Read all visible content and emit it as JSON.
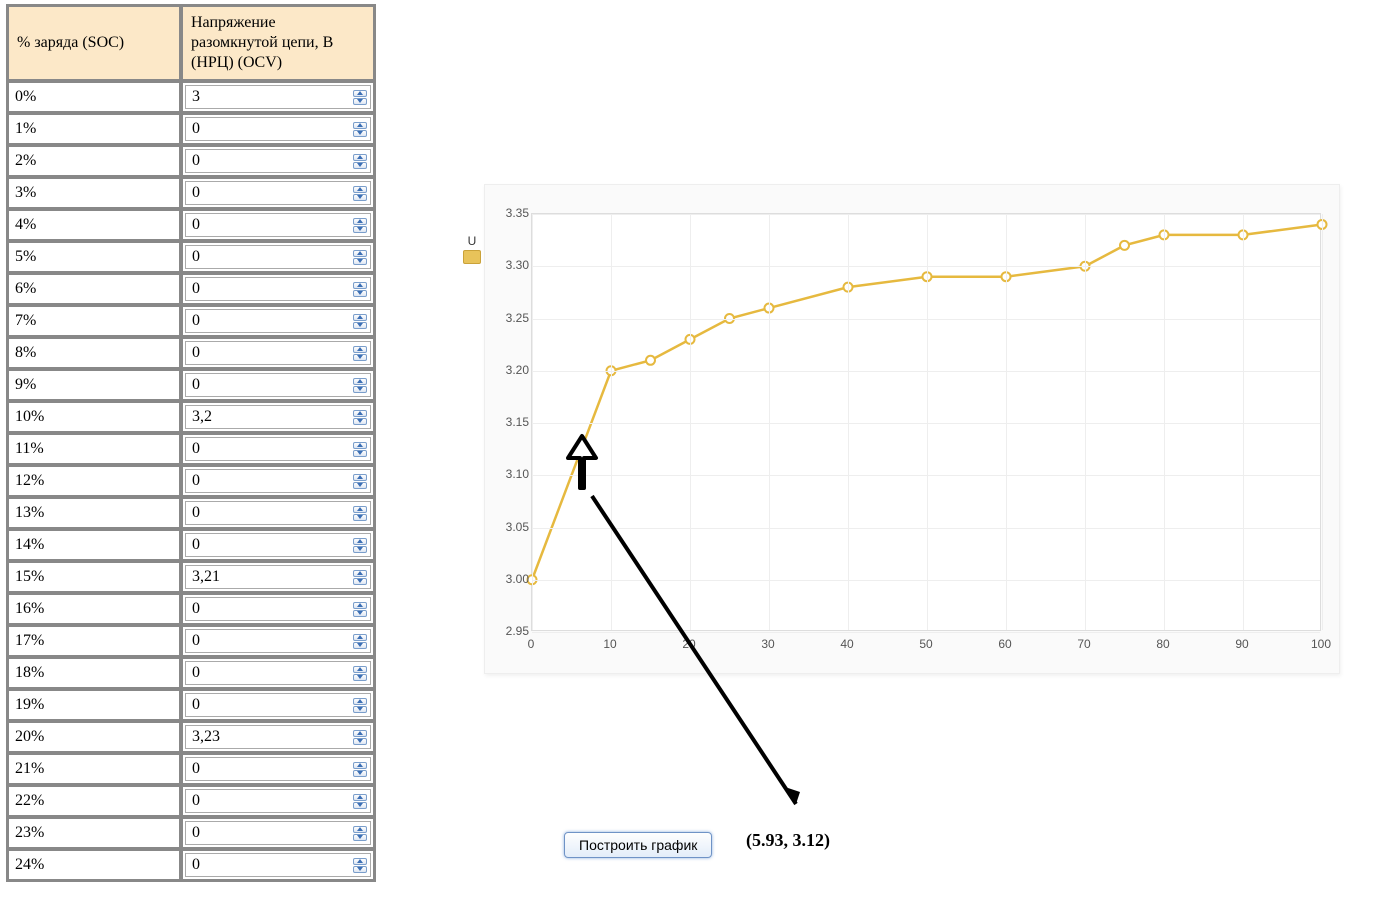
{
  "table": {
    "headers": {
      "soc": "% заряда (SOC)",
      "ocv": "Напряжение разомкнутой цепи, В (НРЦ) (OCV)"
    },
    "rows": [
      {
        "soc": "0%",
        "val": "3"
      },
      {
        "soc": "1%",
        "val": "0"
      },
      {
        "soc": "2%",
        "val": "0"
      },
      {
        "soc": "3%",
        "val": "0"
      },
      {
        "soc": "4%",
        "val": "0"
      },
      {
        "soc": "5%",
        "val": "0"
      },
      {
        "soc": "6%",
        "val": "0"
      },
      {
        "soc": "7%",
        "val": "0"
      },
      {
        "soc": "8%",
        "val": "0"
      },
      {
        "soc": "9%",
        "val": "0"
      },
      {
        "soc": "10%",
        "val": "3,2"
      },
      {
        "soc": "11%",
        "val": "0"
      },
      {
        "soc": "12%",
        "val": "0"
      },
      {
        "soc": "13%",
        "val": "0"
      },
      {
        "soc": "14%",
        "val": "0"
      },
      {
        "soc": "15%",
        "val": "3,21"
      },
      {
        "soc": "16%",
        "val": "0"
      },
      {
        "soc": "17%",
        "val": "0"
      },
      {
        "soc": "18%",
        "val": "0"
      },
      {
        "soc": "19%",
        "val": "0"
      },
      {
        "soc": "20%",
        "val": "3,23"
      },
      {
        "soc": "21%",
        "val": "0"
      },
      {
        "soc": "22%",
        "val": "0"
      },
      {
        "soc": "23%",
        "val": "0"
      },
      {
        "soc": "24%",
        "val": "0"
      }
    ]
  },
  "chart_data": {
    "type": "line",
    "title": "",
    "xlabel": "",
    "ylabel": "U",
    "xlim": [
      0,
      100
    ],
    "ylim": [
      2.95,
      3.35
    ],
    "xticks": [
      0,
      10,
      20,
      30,
      40,
      50,
      60,
      70,
      80,
      90,
      100
    ],
    "yticks": [
      2.95,
      3.0,
      3.05,
      3.1,
      3.15,
      3.2,
      3.25,
      3.3,
      3.35
    ],
    "series": [
      {
        "name": "U",
        "color": "#e6b93f",
        "x": [
          0,
          10,
          15,
          20,
          25,
          30,
          40,
          50,
          60,
          70,
          75,
          80,
          90,
          100
        ],
        "values": [
          3.0,
          3.2,
          3.21,
          3.23,
          3.25,
          3.26,
          3.28,
          3.29,
          3.29,
          3.3,
          3.32,
          3.33,
          3.33,
          3.34
        ]
      }
    ]
  },
  "annotation": {
    "coord_label": "(5.93, 3.12)"
  },
  "button": {
    "build": "Построить график"
  }
}
